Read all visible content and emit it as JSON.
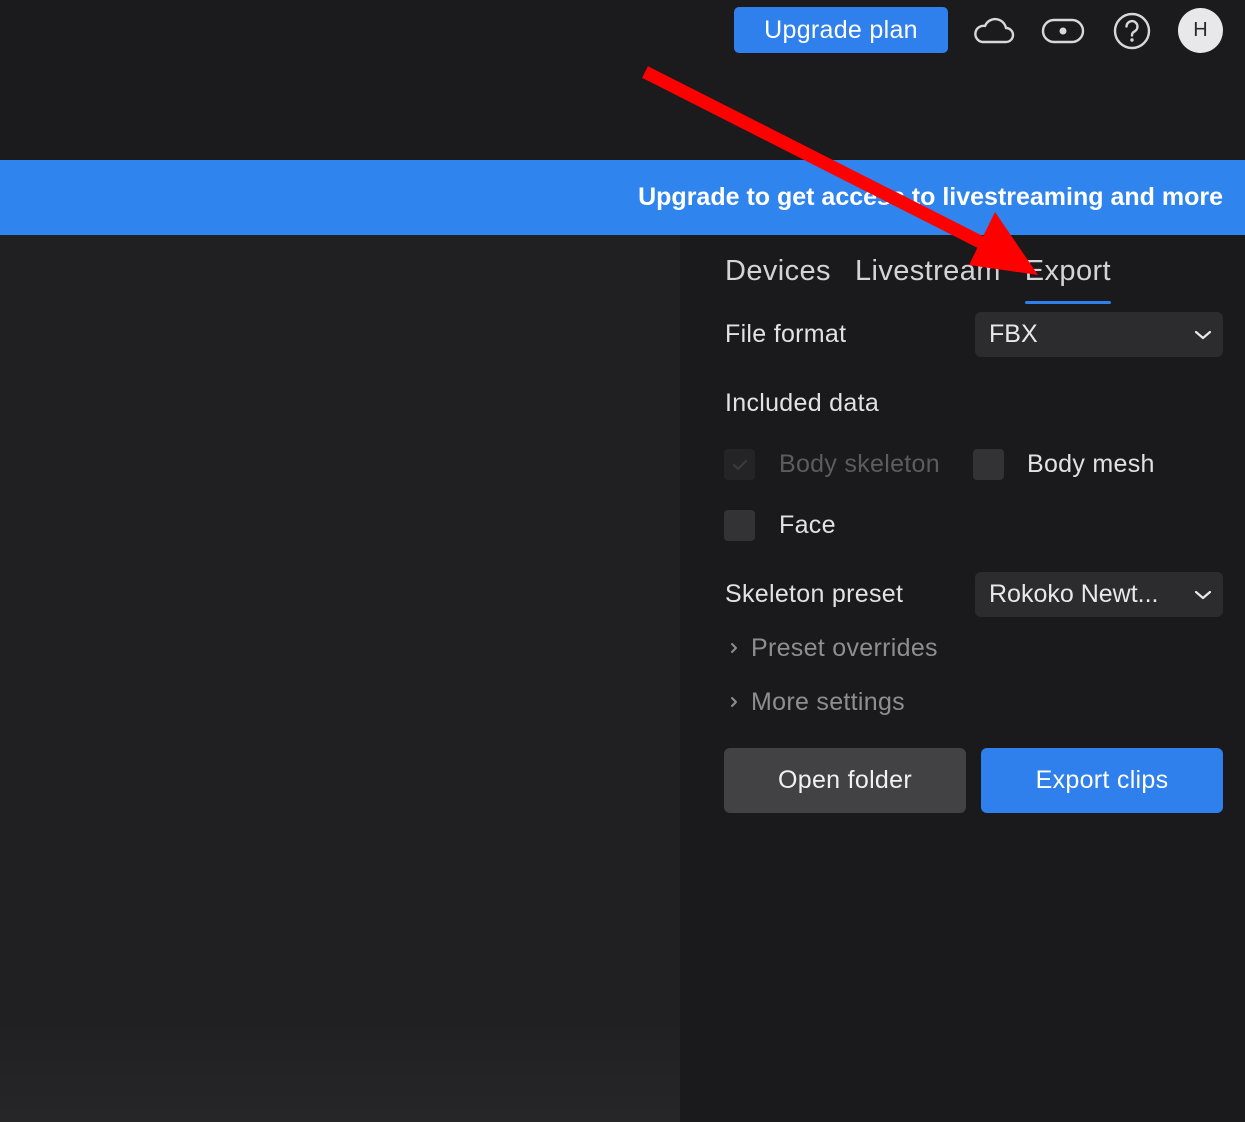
{
  "topbar": {
    "upgrade_label": "Upgrade plan",
    "icons": [
      "cloud-icon",
      "headset-toggle-icon",
      "help-icon"
    ],
    "avatar_initial": "H"
  },
  "banner": {
    "text": "Upgrade to get access to livestreaming and more",
    "color": "#2f84ee"
  },
  "tabs": [
    {
      "label": "Devices",
      "active": false
    },
    {
      "label": "Livestream",
      "active": false
    },
    {
      "label": "Export",
      "active": true
    }
  ],
  "export": {
    "file_format_label": "File format",
    "file_format_value": "FBX",
    "included_data_label": "Included data",
    "checkboxes": [
      {
        "label": "Body skeleton",
        "checked": true,
        "disabled": true
      },
      {
        "label": "Body mesh",
        "checked": false,
        "disabled": false
      },
      {
        "label": "Face",
        "checked": false,
        "disabled": false
      }
    ],
    "skeleton_preset_label": "Skeleton preset",
    "skeleton_preset_value": "Rokoko Newt...",
    "preset_overrides_label": "Preset overrides",
    "more_settings_label": "More settings",
    "open_folder_label": "Open folder",
    "export_clips_label": "Export clips"
  },
  "colors": {
    "accent": "#2f80ed",
    "annotation_arrow": "#ff0000"
  }
}
